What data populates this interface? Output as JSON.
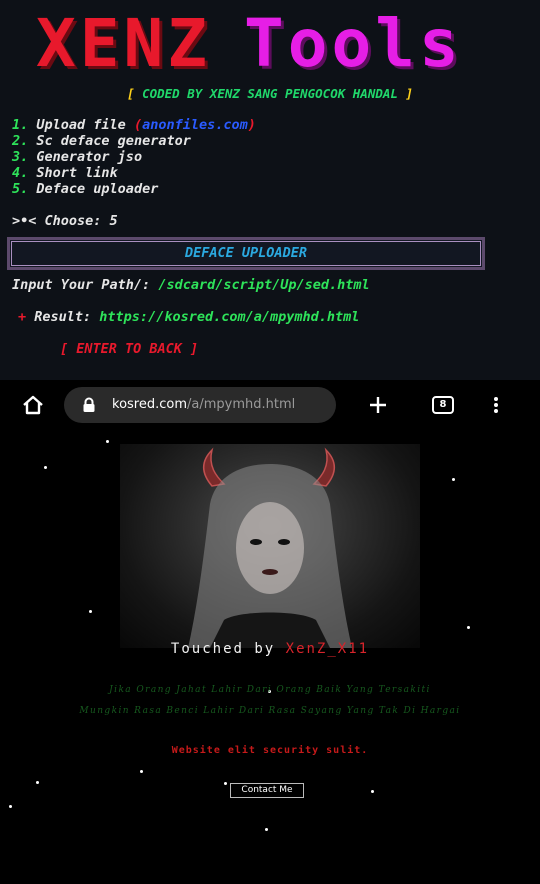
{
  "terminal": {
    "logo_left": "XENZ",
    "logo_right": "Tools",
    "coded_open": "[ ",
    "coded_text": "CODED BY XENZ SANG PENGOCOK HANDAL",
    "coded_close": " ]",
    "menu": [
      {
        "num": "1.",
        "label": "Upload file ",
        "extra_open": "(",
        "extra_link": "anonfiles.com",
        "extra_close": ")"
      },
      {
        "num": "2.",
        "label": "Sc deface generator"
      },
      {
        "num": "3.",
        "label": "Generator jso"
      },
      {
        "num": "4.",
        "label": "Short link"
      },
      {
        "num": "5.",
        "label": "Deface uploader"
      }
    ],
    "choose_prompt": ">•< Choose: ",
    "choose_value": "5",
    "section_title": "DEFACE UPLOADER",
    "input_label": "Input Your Path/: ",
    "input_value": "/sdcard/script/Up/sed.html",
    "result_marker": "+",
    "result_label": " Result: ",
    "result_value": "https://kosred.com/a/mpymhd.html",
    "back_text": "[ ENTER TO BACK ]"
  },
  "browser": {
    "home_icon": "home-icon",
    "lock_icon": "lock-icon",
    "url_domain": "kosred.com",
    "url_path": "/a/mpymhd.html",
    "new_tab_icon": "plus-icon",
    "tab_count": "8",
    "menu_icon": "more-vertical-icon"
  },
  "webpage": {
    "touched_prefix": "Touched by ",
    "touched_name": "XenZ_X11",
    "quote_line1": "Jika Orang Jahat Lahir Dari Orang Baik Yang Tersakiti",
    "quote_line2": "Mungkin Rasa Benci Lahir Dari Rasa Sayang Yang Tak Di Hargai",
    "tagline": "Website elit security sulit.",
    "contact_button": "Contact Me"
  },
  "colors": {
    "terminal_bg": "#0d1117",
    "logo_red": "#e8192c",
    "logo_pink": "#e61ee6",
    "terminal_green": "#2ee35a",
    "accent_blue": "#2ba9e0",
    "page_bg": "#000000"
  }
}
